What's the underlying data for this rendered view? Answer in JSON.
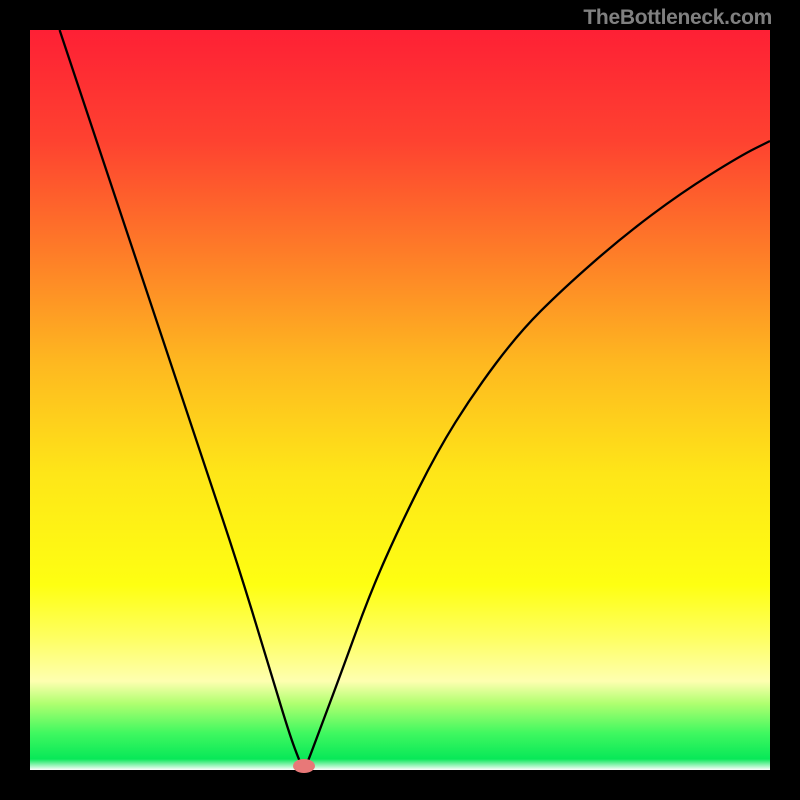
{
  "watermark": "TheBottleneck.com",
  "chart_data": {
    "type": "line",
    "title": "",
    "xlabel": "",
    "ylabel": "",
    "xlim": [
      0,
      100
    ],
    "ylim": [
      0,
      100
    ],
    "minimum_x": 37,
    "gradient_stops": [
      {
        "offset": 0,
        "color": "#fe2035"
      },
      {
        "offset": 15,
        "color": "#fe4230"
      },
      {
        "offset": 30,
        "color": "#fe7c28"
      },
      {
        "offset": 45,
        "color": "#feb820"
      },
      {
        "offset": 60,
        "color": "#fee618"
      },
      {
        "offset": 75,
        "color": "#feff12"
      },
      {
        "offset": 82,
        "color": "#feff60"
      },
      {
        "offset": 88,
        "color": "#feffb0"
      },
      {
        "offset": 91,
        "color": "#b0ff70"
      },
      {
        "offset": 95,
        "color": "#40f860"
      },
      {
        "offset": 98.5,
        "color": "#08e858"
      },
      {
        "offset": 100,
        "color": "#fefefe"
      }
    ],
    "series": [
      {
        "name": "bottleneck-curve",
        "x": [
          4,
          8,
          12,
          16,
          20,
          24,
          28,
          32,
          35,
          36.5,
          37,
          37.5,
          39,
          42,
          46,
          50,
          55,
          60,
          66,
          72,
          80,
          88,
          96,
          100
        ],
        "y": [
          100,
          88,
          76,
          64,
          52,
          40,
          28,
          15,
          5,
          1,
          0,
          1,
          5,
          13,
          24,
          33,
          43,
          51,
          59,
          65,
          72,
          78,
          83,
          85
        ]
      }
    ],
    "marker": {
      "x": 37,
      "y": 0.5,
      "color": "#e87878"
    }
  }
}
